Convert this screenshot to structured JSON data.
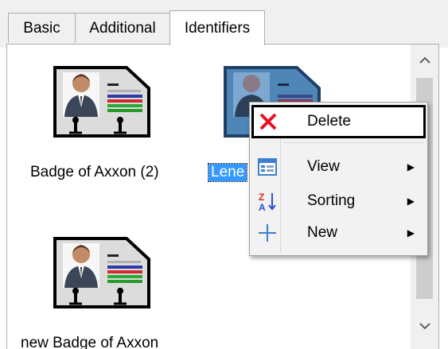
{
  "tabs": [
    {
      "label": "Basic"
    },
    {
      "label": "Additional"
    },
    {
      "label": "Identifiers",
      "active": true
    }
  ],
  "items": [
    {
      "label": "Badge of Axxon (2)",
      "icon": "badge-icon"
    },
    {
      "label": "Lene",
      "icon": "badge-icon",
      "selected": true
    },
    {
      "label": "new Badge of Axxon",
      "icon": "badge-icon"
    }
  ],
  "context_menu": {
    "items": [
      {
        "label": "Delete",
        "icon": "delete-x-icon",
        "submenu": false
      },
      {
        "label": "View",
        "icon": "view-list-icon",
        "submenu": true
      },
      {
        "label": "Sorting",
        "icon": "sort-az-icon",
        "submenu": true
      },
      {
        "label": "New",
        "icon": "plus-icon",
        "submenu": true
      }
    ]
  },
  "colors": {
    "selection": "#3399ff",
    "delete_icon": "#e81123",
    "plus_icon": "#3c7fd1"
  }
}
